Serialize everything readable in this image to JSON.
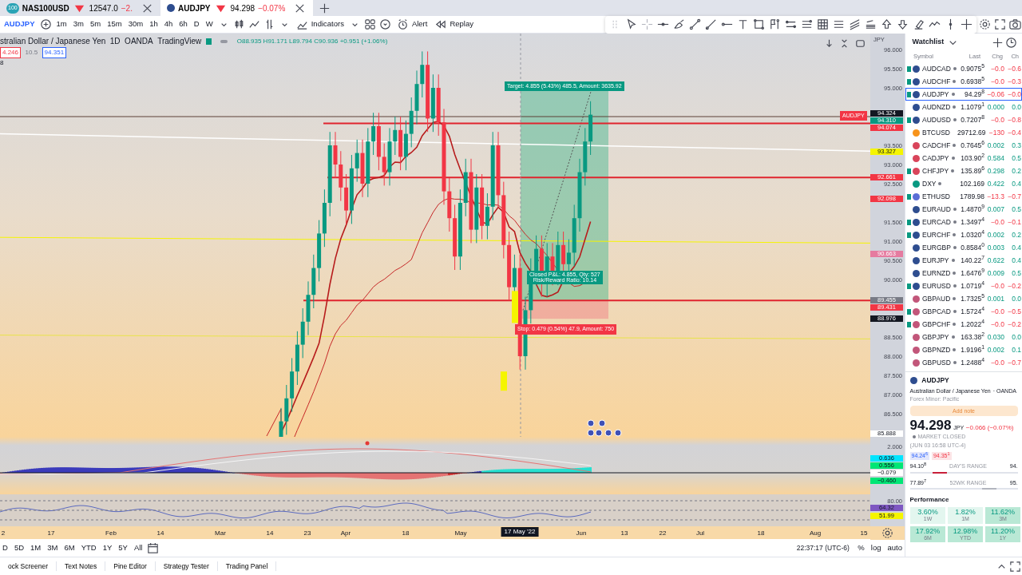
{
  "tabs": [
    {
      "badge": "100",
      "symbol": "NAS100USD",
      "price": "12547.0",
      "change": "−2.",
      "selected": false
    },
    {
      "symbol": "AUDJPY",
      "price": "94.298",
      "change": "−0.07%",
      "selected": true
    }
  ],
  "toolbar": {
    "symbol": "AUDJPY",
    "intervals": [
      "1m",
      "3m",
      "5m",
      "15m",
      "30m",
      "1h",
      "4h",
      "6h",
      "D",
      "W"
    ],
    "indicators": "Indicators",
    "alert": "Alert",
    "replay": "Replay"
  },
  "legend": {
    "title": "stralian Dollar / Japanese Yen",
    "interval": "1D",
    "exchange": "OANDA",
    "source": "TradingView",
    "ohlc": "O88.935 H91.171 L89.794 C90.936 +0.951 (+1.06%)",
    "bid": "4.246",
    "spread": "10.5",
    "ask": "94.351",
    "indicator": "8"
  },
  "chart_labels": {
    "line_label": "AUDJPY",
    "target": "Target: 4.855 (5.43%) 485.5, Amount: 3635.92",
    "closed": "Closed P&L: 4.855, Qty: 527",
    "ratio": "Risk/Reward Ratio: 10.14",
    "stop": "Stop: 0.479 (0.54%) 47.9, Amount: 750"
  },
  "price_axis": {
    "currency": "JPY",
    "ticks": [
      "96.000",
      "95.500",
      "95.000",
      "93.500",
      "93.000",
      "92.500",
      "91.500",
      "91.000",
      "90.500",
      "90.000",
      "88.500",
      "88.000",
      "87.500",
      "87.000",
      "86.500"
    ],
    "tags": [
      {
        "label": "94.324",
        "color": "#131722"
      },
      {
        "label": "94.310",
        "color": "#089981"
      },
      {
        "label": "94.074",
        "color": "#f23645"
      },
      {
        "label": "93.327",
        "color": "#f5f500"
      },
      {
        "label": "92.661",
        "color": "#f23645"
      },
      {
        "label": "92.098",
        "color": "#f23645"
      },
      {
        "label": "90.663",
        "color": "#e57ba0"
      },
      {
        "label": "89.455",
        "color": "#787b86"
      },
      {
        "label": "89.431",
        "color": "#f23645"
      },
      {
        "label": "88.976",
        "color": "#131722"
      },
      {
        "label": "85.888",
        "color": "#ffffff"
      }
    ]
  },
  "macd_axis": [
    {
      "label": "2.000"
    },
    {
      "label": "0.636",
      "color": "#00e5ff"
    },
    {
      "label": "0.556",
      "color": "#00e676"
    },
    {
      "label": "−0.079",
      "color": "#ffffff"
    },
    {
      "label": "−0.460",
      "color": "#00e676"
    }
  ],
  "rsi_axis": [
    {
      "label": "80.00"
    },
    {
      "label": "64.32",
      "color": "#7e57c2"
    },
    {
      "label": "51.99",
      "color": "#f5f500"
    }
  ],
  "time_axis": [
    {
      "label": "2",
      "selected": false
    },
    {
      "label": "17",
      "selected": false
    },
    {
      "label": "Feb",
      "selected": false
    },
    {
      "label": "14",
      "selected": false
    },
    {
      "label": "Mar",
      "selected": false
    },
    {
      "label": "14",
      "selected": false
    },
    {
      "label": "23",
      "selected": false
    },
    {
      "label": "Apr",
      "selected": false
    },
    {
      "label": "18",
      "selected": false
    },
    {
      "label": "May",
      "selected": false
    },
    {
      "label": "17 May '22",
      "selected": true
    },
    {
      "label": "Jun",
      "selected": false
    },
    {
      "label": "13",
      "selected": false
    },
    {
      "label": "22",
      "selected": false
    },
    {
      "label": "Jul",
      "selected": false
    },
    {
      "label": "18",
      "selected": false
    },
    {
      "label": "Aug",
      "selected": false
    },
    {
      "label": "15",
      "selected": false
    }
  ],
  "ranges": [
    "D",
    "5D",
    "1M",
    "3M",
    "6M",
    "YTD",
    "1Y",
    "5Y",
    "All"
  ],
  "clock": "22:37:17 (UTC-6)",
  "scale_options": [
    "%",
    "log",
    "auto"
  ],
  "bottom_tabs": [
    "ock Screener",
    "Text Notes",
    "Pine Editor",
    "Strategy Tester",
    "Trading Panel"
  ],
  "watchlist": {
    "title": "Watchlist",
    "columns": [
      "Symbol",
      "Last",
      "Chg",
      "Ch"
    ],
    "rows": [
      {
        "symbol": "AUDCAD",
        "last": "0.9075$^{5}$",
        "chg": "−0.0",
        "chgp": "−0.6",
        "down": true,
        "flagged": true,
        "dot": true,
        "color": "#2e4d8f",
        "selected": false
      },
      {
        "symbol": "AUDCHF",
        "last": "0.6938$^{5}$",
        "chg": "−0.0",
        "chgp": "−0.3",
        "down": true,
        "flagged": true,
        "dot": true,
        "color": "#2e4d8f",
        "selected": false
      },
      {
        "symbol": "AUDJPY",
        "last": "94.29$^{8}$",
        "chg": "−0.06",
        "chgp": "−0.0",
        "down": true,
        "flagged": true,
        "dot": true,
        "color": "#2e4d8f",
        "selected": true
      },
      {
        "symbol": "AUDNZD",
        "last": "1.1079$^{1}$",
        "chg": "0.000",
        "chgp": "0.0",
        "down": false,
        "flagged": false,
        "dot": true,
        "color": "#2e4d8f",
        "selected": false
      },
      {
        "symbol": "AUDUSD",
        "last": "0.7207$^{8}$",
        "chg": "−0.0",
        "chgp": "−0.8",
        "down": true,
        "flagged": true,
        "dot": true,
        "color": "#2e4d8f",
        "selected": false
      },
      {
        "symbol": "BTCUSD",
        "last": "29712.69",
        "chg": "−130",
        "chgp": "−0.4",
        "down": true,
        "flagged": false,
        "dot": false,
        "color": "#f7931a",
        "selected": false
      },
      {
        "symbol": "CADCHF",
        "last": "0.7645$^{6}$",
        "chg": "0.002",
        "chgp": "0.3",
        "down": false,
        "flagged": false,
        "dot": true,
        "color": "#d9445a",
        "selected": false
      },
      {
        "symbol": "CADJPY",
        "last": "103.90$^{2}$",
        "chg": "0.584",
        "chgp": "0.5",
        "down": false,
        "flagged": false,
        "dot": true,
        "color": "#d9445a",
        "selected": false
      },
      {
        "symbol": "CHFJPY",
        "last": "135.89$^{6}$",
        "chg": "0.298",
        "chgp": "0.2",
        "down": false,
        "flagged": true,
        "dot": true,
        "color": "#d9445a",
        "selected": false
      },
      {
        "symbol": "DXY",
        "last": "102.169",
        "chg": "0.422",
        "chgp": "0.4",
        "down": false,
        "flagged": false,
        "dot": true,
        "color": "#089981",
        "selected": false
      },
      {
        "symbol": "ETHUSD",
        "last": "1789.98",
        "chg": "−13.3",
        "chgp": "−0.7",
        "down": true,
        "flagged": true,
        "dot": false,
        "color": "#5b6fd6",
        "selected": false
      },
      {
        "symbol": "EURAUD",
        "last": "1.4870$^{9}$",
        "chg": "0.007",
        "chgp": "0.5",
        "down": false,
        "flagged": false,
        "dot": true,
        "color": "#2e4d8f",
        "selected": false
      },
      {
        "symbol": "EURCAD",
        "last": "1.3497$^{4}$",
        "chg": "−0.0",
        "chgp": "−0.1",
        "down": true,
        "flagged": true,
        "dot": true,
        "color": "#2e4d8f",
        "selected": false
      },
      {
        "symbol": "EURCHF",
        "last": "1.0320$^{4}$",
        "chg": "0.002",
        "chgp": "0.2",
        "down": false,
        "flagged": true,
        "dot": true,
        "color": "#2e4d8f",
        "selected": false
      },
      {
        "symbol": "EURGBP",
        "last": "0.8584$^{0}$",
        "chg": "0.003",
        "chgp": "0.4",
        "down": false,
        "flagged": false,
        "dot": true,
        "color": "#2e4d8f",
        "selected": false
      },
      {
        "symbol": "EURJPY",
        "last": "140.22$^{7}$",
        "chg": "0.622",
        "chgp": "0.4",
        "down": false,
        "flagged": false,
        "dot": true,
        "color": "#2e4d8f",
        "selected": false
      },
      {
        "symbol": "EURNZD",
        "last": "1.6476$^{9}$",
        "chg": "0.009",
        "chgp": "0.5",
        "down": false,
        "flagged": false,
        "dot": true,
        "color": "#2e4d8f",
        "selected": false
      },
      {
        "symbol": "EURUSD",
        "last": "1.0719$^{4}$",
        "chg": "−0.0",
        "chgp": "−0.2",
        "down": true,
        "flagged": true,
        "dot": true,
        "color": "#2e4d8f",
        "selected": false
      },
      {
        "symbol": "GBPAUD",
        "last": "1.7325$^{5}$",
        "chg": "0.001",
        "chgp": "0.0",
        "down": false,
        "flagged": false,
        "dot": true,
        "color": "#c2567a",
        "selected": false
      },
      {
        "symbol": "GBPCAD",
        "last": "1.5724$^{4}$",
        "chg": "−0.0",
        "chgp": "−0.5",
        "down": true,
        "flagged": true,
        "dot": true,
        "color": "#c2567a",
        "selected": false
      },
      {
        "symbol": "GBPCHF",
        "last": "1.2022$^{4}$",
        "chg": "−0.0",
        "chgp": "−0.2",
        "down": true,
        "flagged": true,
        "dot": true,
        "color": "#c2567a",
        "selected": false
      },
      {
        "symbol": "GBPJPY",
        "last": "163.38$^{2}$",
        "chg": "0.030",
        "chgp": "0.0",
        "down": false,
        "flagged": false,
        "dot": true,
        "color": "#c2567a",
        "selected": false
      },
      {
        "symbol": "GBPNZD",
        "last": "1.9196$^{1}$",
        "chg": "0.002",
        "chgp": "0.1",
        "down": false,
        "flagged": false,
        "dot": true,
        "color": "#c2567a",
        "selected": false
      },
      {
        "symbol": "GBPUSD",
        "last": "1.2488$^{4}$",
        "chg": "−0.0",
        "chgp": "−0.7",
        "down": true,
        "flagged": false,
        "dot": true,
        "color": "#c2567a",
        "selected": false
      }
    ]
  },
  "details": {
    "symbol": "AUDJPY",
    "name": "Australian Dollar / Japanese Yen",
    "exchange": "· OANDA",
    "category": "Forex Minor: Pacific",
    "add_note": "Add note",
    "price": "94.298",
    "currency": "JPY",
    "change": "−0.066 (−0.07%)",
    "status": "MARKET CLOSED",
    "status_time": "(JUN 03 16:58 UTC-4)",
    "bid": "94.24$^{6}$",
    "ask": "94.35$^{1}$",
    "day_range": {
      "low": "94.10$^{8}$",
      "label": "DAY'S RANGE",
      "high": "94."
    },
    "year_range": {
      "low": "77.89$^{7}$",
      "label": "52WK RANGE",
      "high": "95."
    },
    "performance_title": "Performance",
    "performance": [
      {
        "value": "3.60%",
        "period": "1W",
        "color": "#e3f6ef"
      },
      {
        "value": "1.82%",
        "period": "1M",
        "color": "#e3f6ef"
      },
      {
        "value": "11.62%",
        "period": "3M",
        "color": "#b9e8d5"
      },
      {
        "value": "17.92%",
        "period": "6M",
        "color": "#b9e8d5"
      },
      {
        "value": "12.98%",
        "period": "YTD",
        "color": "#b9e8d5"
      },
      {
        "value": "11.20%",
        "period": "1Y",
        "color": "#b9e8d5"
      }
    ]
  }
}
